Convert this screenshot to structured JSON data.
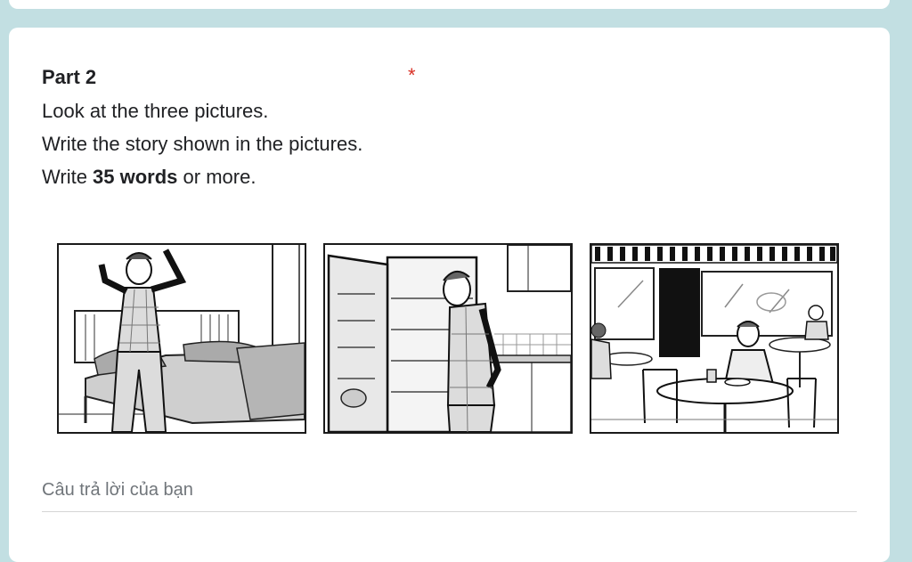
{
  "question": {
    "title": "Part 2",
    "required_mark": "*",
    "line1": "Look at the three pictures.",
    "line2": "Write the story shown in the pictures.",
    "line3_prefix": "Write ",
    "line3_bold": "35 words",
    "line3_suffix": " or more."
  },
  "pictures": [
    {
      "icon": "man-waking-up-stretching"
    },
    {
      "icon": "man-looking-in-fridge"
    },
    {
      "icon": "man-eating-in-cafe"
    }
  ],
  "answer": {
    "placeholder": "Câu trả lời của bạn",
    "value": ""
  },
  "colors": {
    "background": "#c2dfe2",
    "card": "#ffffff",
    "required": "#d93025"
  }
}
